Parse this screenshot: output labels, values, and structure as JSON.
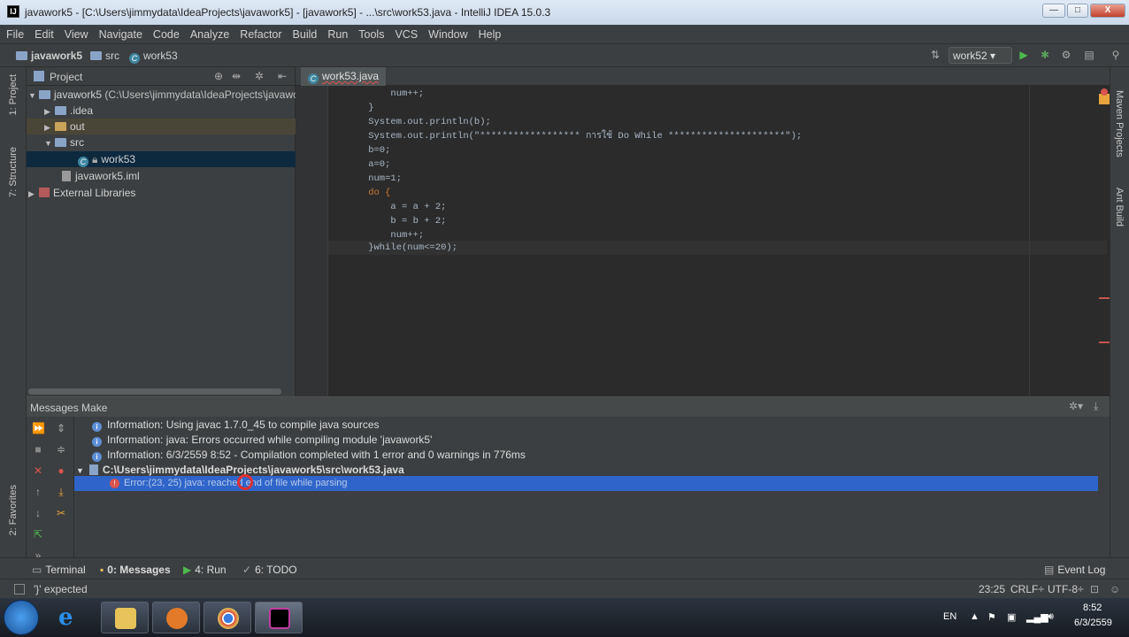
{
  "window": {
    "title": "javawork5 - [C:\\Users\\jimmydata\\IdeaProjects\\javawork5] - [javawork5] - ...\\src\\work53.java - IntelliJ IDEA 15.0.3",
    "minimize": "—",
    "maximize": "□",
    "close": "X"
  },
  "menu": [
    "File",
    "Edit",
    "View",
    "Navigate",
    "Code",
    "Analyze",
    "Refactor",
    "Build",
    "Run",
    "Tools",
    "VCS",
    "Window",
    "Help"
  ],
  "breadcrumb": {
    "project": "javawork5",
    "folder": "src",
    "file": "work53"
  },
  "run_config": "work52",
  "left_strip": {
    "project": "1: Project",
    "structure": "7: Structure",
    "favorites": "2: Favorites"
  },
  "right_strip": {
    "maven": "Maven Projects",
    "ant": "Ant Build"
  },
  "project_panel": {
    "title": "Project",
    "tree": [
      {
        "label": "javawork5",
        "detail": "(C:\\Users\\jimmydata\\IdeaProjects\\javawork"
      },
      {
        "label": ".idea"
      },
      {
        "label": "out"
      },
      {
        "label": "src"
      },
      {
        "label": "work53"
      },
      {
        "label": "javawork5.iml"
      },
      {
        "label": "External Libraries"
      }
    ]
  },
  "editor": {
    "tab": "work53.java",
    "lines": [
      "        num++;",
      "    }",
      "    System.out.println(b);",
      "    System.out.println(\"****************** การใช้ Do While *********************\");",
      "    b=0;",
      "    a=0;",
      "    num=1;",
      "    do {",
      "        a = a + 2;",
      "        b = b + 2;",
      "        num++;",
      "    }while(num<=20);"
    ]
  },
  "messages": {
    "title": "Messages Make",
    "items": [
      "Information: Using javac 1.7.0_45 to compile java sources",
      "Information: java: Errors occurred while compiling module 'javawork5'",
      "Information: 6/3/2559 8:52 - Compilation completed with 1 error and 0 warnings in 776ms",
      "C:\\Users\\jimmydata\\IdeaProjects\\javawork5\\src\\work53.java",
      "Error:(23, 25)  java: reached end of file while parsing"
    ]
  },
  "bottom_tabs": {
    "terminal": "Terminal",
    "messages": "0: Messages",
    "run": "4: Run",
    "todo": "6: TODO",
    "event_log": "Event Log"
  },
  "status": {
    "message": "'}' expected",
    "position": "23:25",
    "line_sep": "CRLF÷",
    "encoding": "UTF-8÷"
  },
  "taskbar": {
    "lang": "EN",
    "time": "8:52",
    "date": "6/3/2559"
  },
  "colors": {
    "keyword": "#cc7832",
    "number": "#6897bb",
    "string": "#6a8759",
    "selection": "#2f65ca",
    "error": "#d9534f"
  }
}
